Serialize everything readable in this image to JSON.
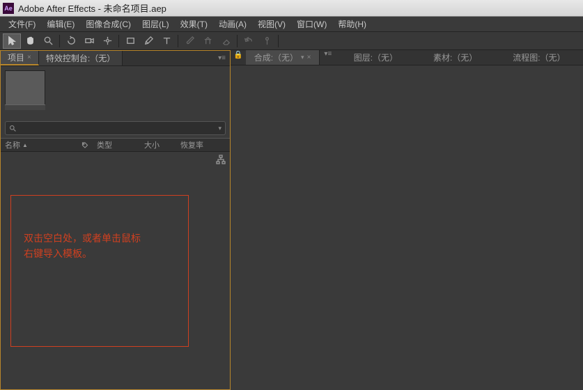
{
  "window": {
    "title": "Adobe After Effects - 未命名项目.aep",
    "icon_label": "Ae"
  },
  "menu": {
    "file": "文件(F)",
    "edit": "编辑(E)",
    "composition": "图像合成(C)",
    "layer": "图层(L)",
    "effect": "效果(T)",
    "animation": "动画(A)",
    "view": "视图(V)",
    "window": "窗口(W)",
    "help": "帮助(H)"
  },
  "left_tabs": {
    "project": "项目",
    "effect_controls": "特效控制台:（无）"
  },
  "search": {
    "placeholder": ""
  },
  "columns": {
    "name": "名称",
    "type": "类型",
    "size": "大小",
    "duration": "恢复率"
  },
  "hint": {
    "line1": "双击空白处，或者单击鼠标",
    "line2": "右键导入模板。"
  },
  "right_tabs": {
    "composition": "合成:（无）",
    "layer": "图层:（无）",
    "footage": "素材:（无）",
    "flowchart": "流程图:（无）"
  }
}
